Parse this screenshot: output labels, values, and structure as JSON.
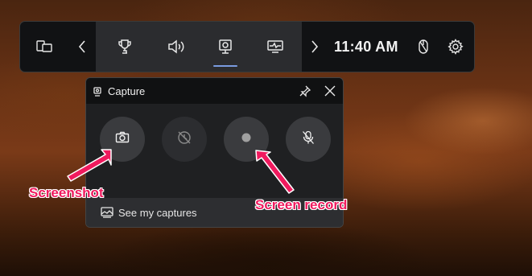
{
  "gamebar": {
    "time": "11:40 AM",
    "icons": [
      "widget-menu-icon",
      "chevron-left-icon",
      "trophy-icon",
      "audio-icon",
      "capture-icon",
      "performance-icon",
      "chevron-right-icon",
      "mouse-icon",
      "gear-icon"
    ],
    "accent": "#7a9be0"
  },
  "capture": {
    "title": "Capture",
    "buttons": [
      "screenshot",
      "record-last-30s",
      "start-recording",
      "mic-toggle"
    ],
    "see_captures": "See my captures"
  },
  "annotations": {
    "screenshot": "Screenshot",
    "screen_record": "Screen record",
    "color": "#f01a5e"
  }
}
